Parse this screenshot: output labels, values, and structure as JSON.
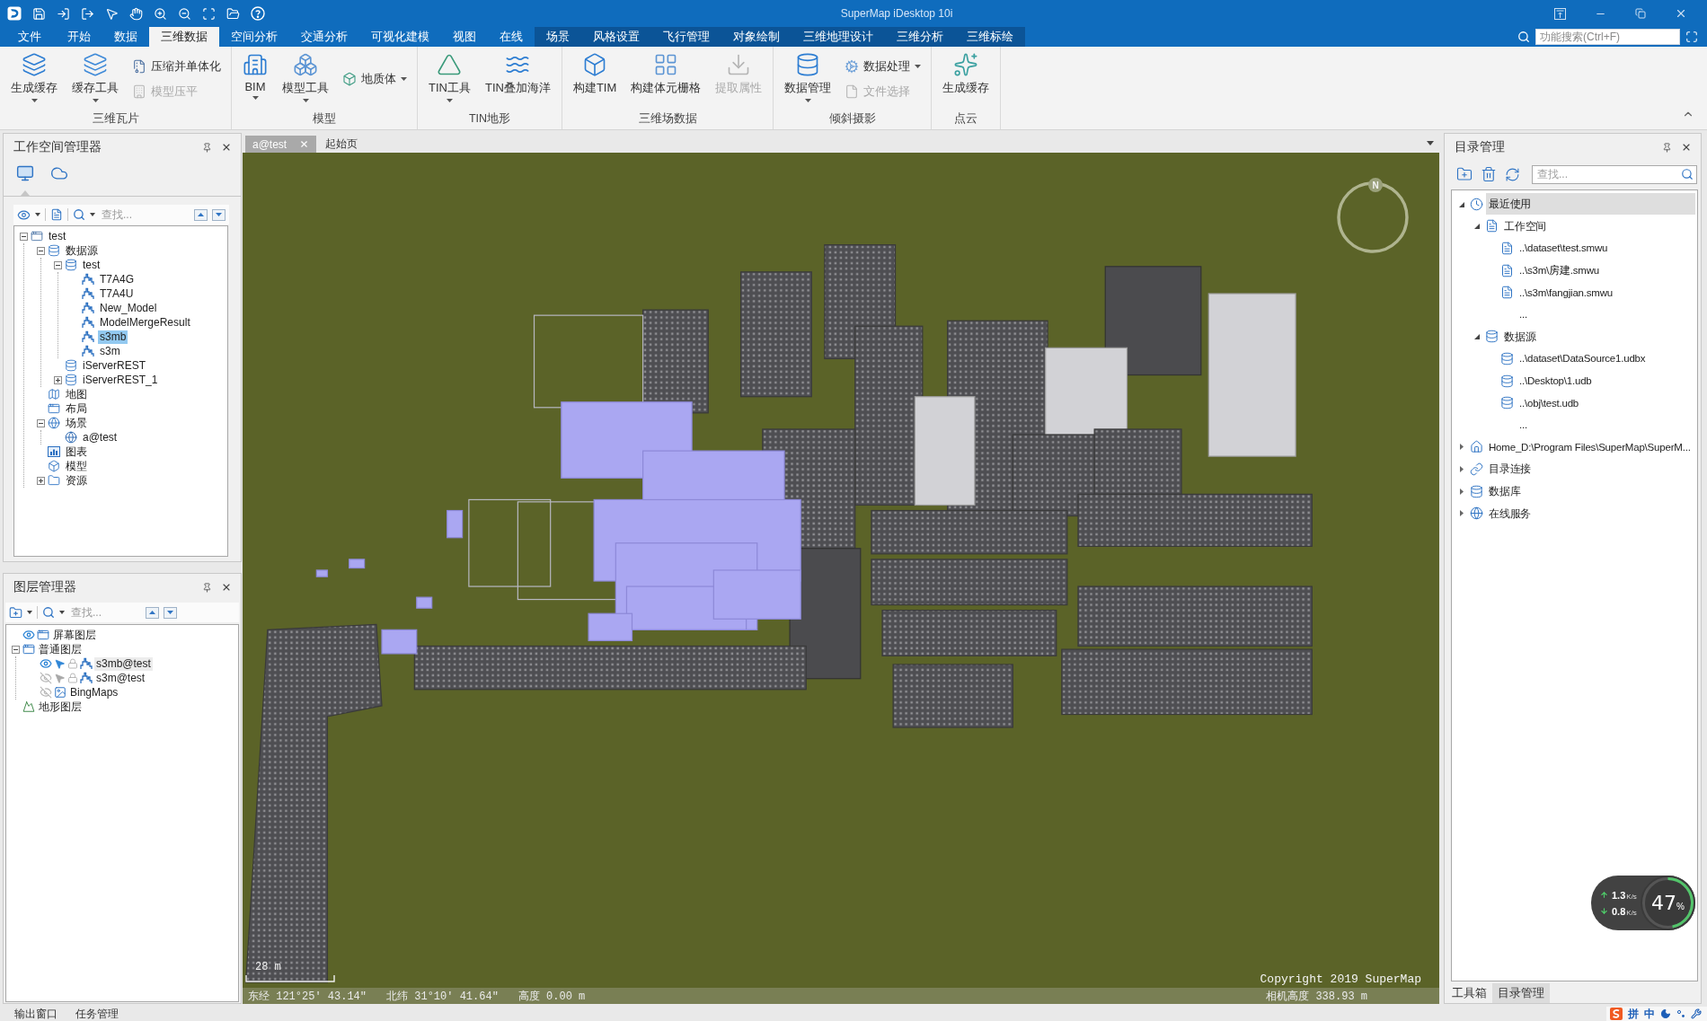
{
  "title_bar": {
    "title": "SuperMap iDesktop 10i"
  },
  "menu_tabs": [
    {
      "label": "文件",
      "kind": "file",
      "selected": false
    },
    {
      "label": "开始",
      "kind": "main",
      "selected": false
    },
    {
      "label": "数据",
      "kind": "main",
      "selected": false
    },
    {
      "label": "三维数据",
      "kind": "main",
      "selected": true
    },
    {
      "label": "空间分析",
      "kind": "main",
      "selected": false
    },
    {
      "label": "交通分析",
      "kind": "main",
      "selected": false
    },
    {
      "label": "可视化建模",
      "kind": "main",
      "selected": false
    },
    {
      "label": "视图",
      "kind": "main",
      "selected": false
    },
    {
      "label": "在线",
      "kind": "main",
      "selected": false
    },
    {
      "label": "场景",
      "kind": "context",
      "selected": false
    },
    {
      "label": "风格设置",
      "kind": "context",
      "selected": false
    },
    {
      "label": "飞行管理",
      "kind": "context",
      "selected": false
    },
    {
      "label": "对象绘制",
      "kind": "context",
      "selected": false
    },
    {
      "label": "三维地理设计",
      "kind": "context",
      "selected": false
    },
    {
      "label": "三维分析",
      "kind": "context",
      "selected": false
    },
    {
      "label": "三维标绘",
      "kind": "context",
      "selected": false
    }
  ],
  "feature_search": {
    "placeholder": "功能搜索(Ctrl+F)"
  },
  "ribbon_groups": [
    {
      "title": "三维瓦片",
      "items": [
        {
          "label": "生成缓存",
          "kind": "large",
          "dropdown": true,
          "disabled": false
        },
        {
          "label": "缓存工具",
          "kind": "large",
          "dropdown": true,
          "disabled": false
        },
        {
          "label": "压缩并单体化",
          "kind": "small",
          "dropdown": false,
          "disabled": false
        },
        {
          "label": "模型压平",
          "kind": "small",
          "dropdown": false,
          "disabled": true
        }
      ]
    },
    {
      "title": "模型",
      "items": [
        {
          "label": "BIM",
          "kind": "large",
          "dropdown": true,
          "disabled": false
        },
        {
          "label": "模型工具",
          "kind": "large",
          "dropdown": true,
          "disabled": false
        },
        {
          "label": "地质体",
          "kind": "small",
          "dropdown": true,
          "disabled": false
        }
      ]
    },
    {
      "title": "TIN地形",
      "items": [
        {
          "label": "TIN工具",
          "kind": "large",
          "dropdown": true,
          "disabled": false
        },
        {
          "label": "TIN叠加海洋",
          "kind": "large",
          "dropdown": false,
          "disabled": false
        }
      ]
    },
    {
      "title": "三维场数据",
      "items": [
        {
          "label": "构建TIM",
          "kind": "large",
          "dropdown": false,
          "disabled": false
        },
        {
          "label": "构建体元栅格",
          "kind": "large",
          "dropdown": false,
          "disabled": false
        },
        {
          "label": "提取属性",
          "kind": "large",
          "dropdown": false,
          "disabled": true
        }
      ]
    },
    {
      "title": "倾斜摄影",
      "items": [
        {
          "label": "数据管理",
          "kind": "large",
          "dropdown": true,
          "disabled": false
        },
        {
          "label": "数据处理",
          "kind": "small",
          "dropdown": true,
          "disabled": false
        },
        {
          "label": "文件选择",
          "kind": "small",
          "dropdown": false,
          "disabled": true
        }
      ]
    },
    {
      "title": "点云",
      "items": [
        {
          "label": "生成缓存",
          "kind": "large",
          "dropdown": false,
          "disabled": false
        }
      ]
    }
  ],
  "workspace_panel": {
    "title": "工作空间管理器",
    "view_tabs": [
      {
        "selected": true
      },
      {
        "selected": false
      }
    ],
    "search": {
      "placeholder": "查找..."
    },
    "tree": [
      {
        "label": "test",
        "kind": "workspace",
        "expanded": true,
        "selected": false,
        "children": [
          {
            "label": "数据源",
            "kind": "datasources",
            "expanded": true,
            "selected": false,
            "children": [
              {
                "label": "test",
                "kind": "udb",
                "expanded": true,
                "selected": false,
                "children": [
                  {
                    "label": "T7A4G",
                    "kind": "model",
                    "selected": false
                  },
                  {
                    "label": "T7A4U",
                    "kind": "model",
                    "selected": false
                  },
                  {
                    "label": "New_Model",
                    "kind": "model",
                    "selected": false
                  },
                  {
                    "label": "ModelMergeResult",
                    "kind": "model",
                    "selected": false
                  },
                  {
                    "label": "s3mb",
                    "kind": "model",
                    "selected": true
                  },
                  {
                    "label": "s3m",
                    "kind": "model",
                    "selected": false
                  }
                ]
              },
              {
                "label": "iServerREST",
                "kind": "iserver",
                "selected": false
              },
              {
                "label": "iServerREST_1",
                "kind": "iserver",
                "expanded": false,
                "selected": false
              }
            ]
          },
          {
            "label": "地图",
            "kind": "maps",
            "selected": false
          },
          {
            "label": "布局",
            "kind": "layouts",
            "selected": false
          },
          {
            "label": "场景",
            "kind": "scenes",
            "expanded": true,
            "selected": false,
            "children": [
              {
                "label": "a@test",
                "kind": "scene",
                "selected": false
              }
            ]
          },
          {
            "label": "图表",
            "kind": "charts",
            "selected": false
          },
          {
            "label": "模型",
            "kind": "models",
            "selected": false
          },
          {
            "label": "资源",
            "kind": "resources",
            "expanded": false,
            "selected": false
          }
        ]
      }
    ]
  },
  "layer_panel": {
    "title": "图层管理器",
    "search": {
      "placeholder": "查找..."
    },
    "tree": [
      {
        "label": "屏幕图层",
        "kind": "screen",
        "visible": true,
        "selected": false
      },
      {
        "label": "普通图层",
        "kind": "group",
        "expanded": true,
        "selected": false,
        "children": [
          {
            "label": "s3mb@test",
            "kind": "model",
            "visible": true,
            "selectable": true,
            "selected": true
          },
          {
            "label": "s3m@test",
            "kind": "model",
            "visible": false,
            "selectable": false,
            "selected": false
          },
          {
            "label": "BingMaps",
            "kind": "image",
            "visible": false,
            "selected": false
          }
        ]
      },
      {
        "label": "地形图层",
        "kind": "terrain",
        "selected": false
      }
    ]
  },
  "bottom_tabs": [
    {
      "label": "输出窗口"
    },
    {
      "label": "任务管理"
    }
  ],
  "document_tabs": [
    {
      "label": "a@test",
      "selected": true
    },
    {
      "label": "起始页",
      "selected": false
    }
  ],
  "scene_view": {
    "compass_label": "N",
    "scale_label": "28 m",
    "copyright": "Copyright 2019 SuperMap",
    "longitude": "东经 121°25′ 43.14″",
    "latitude": "北纬 31°10′ 41.64″",
    "altitude": "高度 0.00 m",
    "camera_height": "相机高度 338.93 m"
  },
  "catalog_panel": {
    "title": "目录管理",
    "search": {
      "placeholder": "查找..."
    },
    "tree": [
      {
        "label": "最近使用",
        "kind": "recent",
        "expanded": true,
        "selected": true,
        "children": [
          {
            "label": "工作空间",
            "kind": "workspaces",
            "expanded": true,
            "selected": false,
            "children": [
              {
                "label": "..\\dataset\\test.smwu",
                "kind": "workspace-file",
                "selected": false
              },
              {
                "label": "..\\s3m\\房建.smwu",
                "kind": "workspace-file",
                "selected": false
              },
              {
                "label": "..\\s3m\\fangjian.smwu",
                "kind": "workspace-file",
                "selected": false
              },
              {
                "label": "...",
                "kind": "more",
                "selected": false
              }
            ]
          },
          {
            "label": "数据源",
            "kind": "datasources",
            "expanded": true,
            "selected": false,
            "children": [
              {
                "label": "..\\dataset\\DataSource1.udbx",
                "kind": "datasource-file",
                "selected": false
              },
              {
                "label": "..\\Desktop\\1.udb",
                "kind": "datasource-file",
                "selected": false
              },
              {
                "label": "..\\obj\\test.udb",
                "kind": "datasource-file",
                "selected": false
              },
              {
                "label": "...",
                "kind": "more",
                "selected": false
              }
            ]
          }
        ]
      },
      {
        "label": "Home_D:\\Program Files\\SuperMap\\SuperM...",
        "kind": "home",
        "expanded": false,
        "selected": false
      },
      {
        "label": "目录连接",
        "kind": "link",
        "expanded": false,
        "selected": false
      },
      {
        "label": "数据库",
        "kind": "database",
        "expanded": false,
        "selected": false
      },
      {
        "label": "在线服务",
        "kind": "online",
        "expanded": false,
        "selected": false
      }
    ]
  },
  "catalog_tabs": [
    {
      "label": "工具箱",
      "selected": false
    },
    {
      "label": "目录管理",
      "selected": true
    }
  ],
  "network_widget": {
    "upload": {
      "rate": "1.3",
      "unit": "K/s"
    },
    "download": {
      "rate": "0.8",
      "unit": "K/s"
    },
    "usage": "47",
    "usage_unit": "%",
    "level": 0.47
  },
  "ime_bar": {
    "mode": "拼",
    "language": "中"
  }
}
